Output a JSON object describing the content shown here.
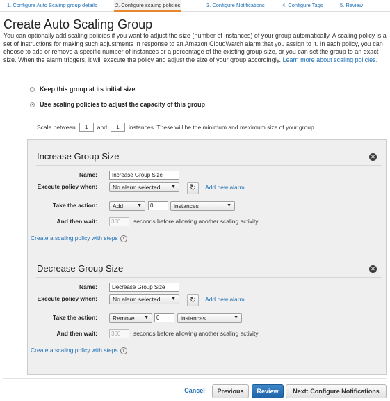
{
  "wizard": {
    "steps": [
      {
        "label": "1. Configure Auto Scaling group details"
      },
      {
        "label": "2. Configure scaling policies"
      },
      {
        "label": "3. Configure Notifications"
      },
      {
        "label": "4. Configure Tags"
      },
      {
        "label": "5. Review"
      }
    ],
    "active_step": 2
  },
  "page": {
    "title": "Create Auto Scaling Group",
    "intro": "You can optionally add scaling policies if you want to adjust the size (number of instances) of your group automatically. A scaling policy is a set of instructions for making such adjustments in response to an Amazon CloudWatch alarm that you assign to it. In each policy, you can choose to add or remove a specific number of instances or a percentage of the existing group size, or you can set the group to an exact size. When the alarm triggers, it will execute the policy and adjust the size of your group accordingly.",
    "learn_more": "Learn more about scaling policies."
  },
  "options": {
    "keep_initial": "Keep this group at its initial size",
    "use_policies": "Use scaling policies to adjust the capacity of this group",
    "selected": "use_policies"
  },
  "scale": {
    "prefix": "Scale between",
    "min": "1",
    "and": "and",
    "max": "1",
    "suffix": "instances. These will be the minimum and maximum size of your group."
  },
  "labels": {
    "name": "Name:",
    "execute": "Execute policy when:",
    "action": "Take the action:",
    "wait": "And then wait:",
    "wait_suffix": "seconds before allowing another scaling activity",
    "add_alarm": "Add new alarm",
    "steps_link": "Create a scaling policy with steps"
  },
  "increase": {
    "title": "Increase Group Size",
    "name_value": "Increase Group Size",
    "alarm": "No alarm selected",
    "action": "Add",
    "amount": "0",
    "unit": "instances",
    "wait_placeholder": "300"
  },
  "decrease": {
    "title": "Decrease Group Size",
    "name_value": "Decrease Group Size",
    "alarm": "No alarm selected",
    "action": "Remove",
    "amount": "0",
    "unit": "instances",
    "wait_placeholder": "300"
  },
  "footer": {
    "cancel": "Cancel",
    "previous": "Previous",
    "review": "Review",
    "next": "Next: Configure Notifications"
  },
  "icons": {
    "close": "close-icon",
    "refresh": "refresh-icon",
    "info": "info-icon",
    "caret": "chevron-down-icon"
  },
  "colors": {
    "link": "#1f6fb5",
    "active_tab_underline": "#e7872d",
    "primary_button": "#2a72b8",
    "panel_background": "#efefef"
  }
}
